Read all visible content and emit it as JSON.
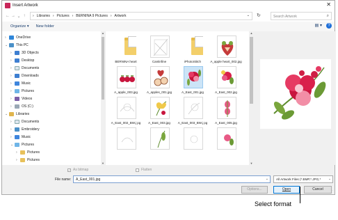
{
  "window": {
    "title": "Insert Artwork",
    "close_glyph": "✕"
  },
  "address": {
    "back": "←",
    "forward": "→",
    "recent": "⌄",
    "up": "↑",
    "path": [
      "›",
      "Libraries",
      "›",
      "Pictures",
      "›",
      "BERNINA 9 Pictures",
      "›",
      "Artwork"
    ],
    "dropdown": "⌄",
    "refresh": "↻",
    "search_placeholder": "Search Artwork"
  },
  "toolbar": {
    "organize": "Organize ▾",
    "new_folder": "New folder",
    "view": "▤ ▾",
    "help": "?"
  },
  "nav": [
    {
      "label": "OneDrive",
      "chev": "›",
      "icon": "ic-cloud",
      "indent": 0
    },
    {
      "label": "This PC",
      "chev": "⌄",
      "icon": "ic-pc",
      "indent": 0
    },
    {
      "label": "3D Objects",
      "chev": "›",
      "icon": "ic-blue",
      "indent": 1
    },
    {
      "label": "Desktop",
      "chev": "›",
      "icon": "ic-blue",
      "indent": 1
    },
    {
      "label": "Documents",
      "chev": "›",
      "icon": "ic-doc",
      "indent": 1
    },
    {
      "label": "Downloads",
      "chev": "›",
      "icon": "ic-blue",
      "indent": 1
    },
    {
      "label": "Music",
      "chev": "›",
      "icon": "ic-music",
      "indent": 1
    },
    {
      "label": "Pictures",
      "chev": "›",
      "icon": "ic-pics",
      "indent": 1
    },
    {
      "label": "Videos",
      "chev": "›",
      "icon": "ic-video",
      "indent": 1
    },
    {
      "label": "OS (C:)",
      "chev": "›",
      "icon": "ic-os",
      "indent": 1
    },
    {
      "label": "Libraries",
      "chev": "⌄",
      "icon": "ic-lib",
      "indent": 0
    },
    {
      "label": "Documents",
      "chev": "›",
      "icon": "ic-doc",
      "indent": 1
    },
    {
      "label": "Embroidery",
      "chev": "›",
      "icon": "ic-pc",
      "indent": 1
    },
    {
      "label": "Music",
      "chev": "›",
      "icon": "ic-music",
      "indent": 1
    },
    {
      "label": "Pictures",
      "chev": "⌄",
      "icon": "ic-pics",
      "indent": 1
    },
    {
      "label": "Pictures",
      "chev": "›",
      "icon": "ic-folder",
      "indent": 2
    },
    {
      "label": "Pictures",
      "chev": "›",
      "icon": "ic-folder",
      "indent": 2
    }
  ],
  "files": [
    {
      "label": "BERNINA heart",
      "kind": "folder",
      "selected": false
    },
    {
      "label": "Cantinfine",
      "kind": "art",
      "selected": false
    },
    {
      "label": "iPhotoStitch",
      "kind": "folder",
      "selected": false
    },
    {
      "label": "A_apple heart_002.jpg",
      "kind": "art",
      "selected": false
    },
    {
      "label": "A_apple_003.jpg",
      "kind": "art",
      "selected": false
    },
    {
      "label": "A_apples_001.jpg",
      "kind": "art",
      "selected": false
    },
    {
      "label": "A_East_001.jpg",
      "kind": "art",
      "selected": true
    },
    {
      "label": "A_East_002.jpg",
      "kind": "art",
      "selected": false
    },
    {
      "label": "A_East_002_BW.j pg",
      "kind": "art",
      "selected": false
    },
    {
      "label": "A_East_003.jpg",
      "kind": "art",
      "selected": false
    },
    {
      "label": "A_East_003_BW.j pg",
      "kind": "art",
      "selected": false
    },
    {
      "label": "A_East_005.jpg",
      "kind": "art",
      "selected": false
    },
    {
      "label": "",
      "kind": "art",
      "selected": false
    },
    {
      "label": "",
      "kind": "art",
      "selected": false
    },
    {
      "label": "",
      "kind": "art",
      "selected": false
    },
    {
      "label": "",
      "kind": "art",
      "selected": false
    }
  ],
  "options": {
    "as_bitmap": "As bitmap",
    "flatten": "Flatten",
    "as_bitmap_check": "✓"
  },
  "filename": {
    "label": "File name:",
    "value": "A_East_001.jpg",
    "dropdown": "⌄"
  },
  "filter": {
    "value": "All Artwork Files (*.BMP,*.JPG,*",
    "dropdown": "⌄"
  },
  "buttons": {
    "options": "Options...",
    "open": "Open",
    "cancel": "Cancel"
  },
  "scroll": {
    "up": "▲",
    "down": "▼",
    "grip": "⋰"
  },
  "annotation": {
    "text": "Select format"
  }
}
